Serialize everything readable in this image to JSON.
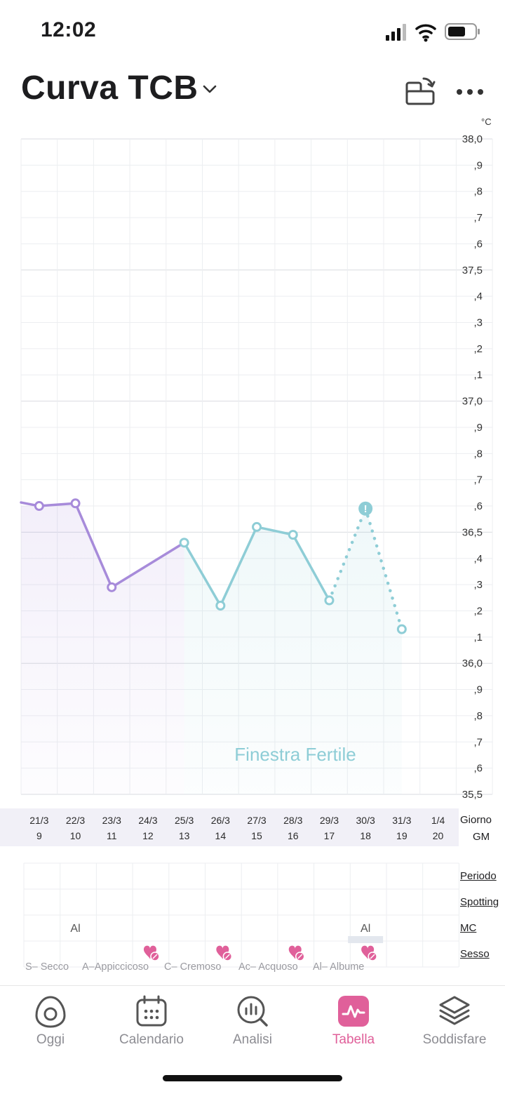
{
  "status": {
    "time": "12:02"
  },
  "header": {
    "title": "Curva TCB"
  },
  "chart": {
    "unit": "°C",
    "y_labels": [
      "38,0",
      ",9",
      ",8",
      ",7",
      ",6",
      "37,5",
      ",4",
      ",3",
      ",2",
      ",1",
      "37,0",
      ",9",
      ",8",
      ",7",
      ",6",
      "36,5",
      ",4",
      ",3",
      ",2",
      ",1",
      "36,0",
      ",9",
      ",8",
      ",7",
      ",6",
      "35,5"
    ],
    "fertile_window_label": "Finestra Fertile",
    "colors": {
      "phase1": "#a78bda",
      "fertile": "#8ecdd6",
      "alert": "#8ecdd6",
      "accent": "#e0609a"
    }
  },
  "chart_data": {
    "type": "line",
    "x": [
      "21/3",
      "22/3",
      "23/3",
      "24/3",
      "25/3",
      "26/3",
      "27/3",
      "28/3",
      "29/3",
      "30/3",
      "31/3",
      "1/4"
    ],
    "cycle_day": [
      "9",
      "10",
      "11",
      "12",
      "13",
      "14",
      "15",
      "16",
      "17",
      "18",
      "19",
      "20"
    ],
    "ylim": [
      35.5,
      38.0
    ],
    "series": [
      {
        "values": [
          36.6,
          36.61,
          36.29,
          null,
          36.46,
          36.22,
          36.52,
          36.49,
          36.24,
          36.59,
          36.13,
          null
        ]
      }
    ],
    "fertile_window": [
      "25/3",
      "31/3"
    ],
    "estimated_points": [
      "30/3",
      "31/3"
    ]
  },
  "axis": {
    "day_label": "Giorno",
    "cycle_label": "GM"
  },
  "symptoms": {
    "rows": [
      "Periodo",
      "Spotting",
      "MC",
      "Sesso"
    ],
    "mucus_entries": [
      {
        "date": "22/3",
        "text": "Al"
      },
      {
        "date": "30/3",
        "text": "Al"
      }
    ],
    "sex_dates": [
      "24/3",
      "26/3",
      "28/3",
      "30/3"
    ],
    "legend": [
      "S– Secco",
      "A–Appiccicoso",
      "C– Cremoso",
      "Ac– Acquoso",
      "Al– Albume"
    ]
  },
  "nav": [
    {
      "label": "Oggi",
      "icon": "egg-icon"
    },
    {
      "label": "Calendario",
      "icon": "calendar-icon"
    },
    {
      "label": "Analisi",
      "icon": "analysis-icon"
    },
    {
      "label": "Tabella",
      "icon": "chart-pulse-icon",
      "active": true
    },
    {
      "label": "Soddisfare",
      "icon": "layers-icon"
    }
  ]
}
